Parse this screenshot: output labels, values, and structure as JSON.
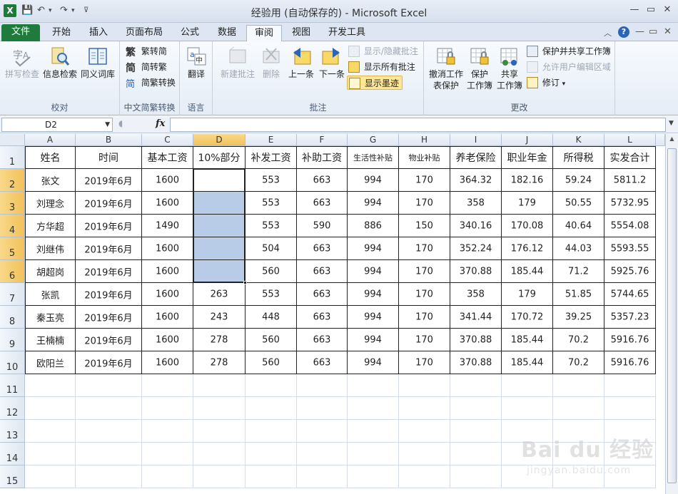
{
  "window": {
    "title": "经验用 (自动保存的) - Microsoft Excel",
    "app_icon": "X"
  },
  "tabs": [
    {
      "label": "文件"
    },
    {
      "label": "开始"
    },
    {
      "label": "插入"
    },
    {
      "label": "页面布局"
    },
    {
      "label": "公式"
    },
    {
      "label": "数据"
    },
    {
      "label": "审阅"
    },
    {
      "label": "视图"
    },
    {
      "label": "开发工具"
    }
  ],
  "active_tab": "审阅",
  "ribbon": {
    "proofing": {
      "label": "校对",
      "spell": "拼写检查",
      "research": "信息检索",
      "thesaurus": "同义词库"
    },
    "chinese": {
      "label": "中文简繁转换",
      "to_simplified_icon": "繁",
      "to_simplified": "繁转简",
      "to_traditional_icon": "简",
      "to_traditional": "简转繁",
      "convert_icon": "简",
      "convert": "简繁转换"
    },
    "language": {
      "label": "语言",
      "translate": "翻译"
    },
    "comments": {
      "label": "批注",
      "new": "新建批注",
      "delete": "删除",
      "prev": "上一条",
      "next": "下一条",
      "show_hide": "显示/隐藏批注",
      "show_all": "显示所有批注",
      "show_ink": "显示墨迹"
    },
    "changes": {
      "label": "更改",
      "unprotect_sheet_1": "撤消工作",
      "unprotect_sheet_2": "表保护",
      "protect_wb_1": "保护",
      "protect_wb_2": "工作簿",
      "share_wb_1": "共享",
      "share_wb_2": "工作簿",
      "protect_share": "保护并共享工作簿",
      "allow_edit": "允许用户编辑区域",
      "track": "修订"
    }
  },
  "formula_bar": {
    "name_box": "D2",
    "fx": "fx",
    "formula": ""
  },
  "grid": {
    "columns": [
      "A",
      "B",
      "C",
      "D",
      "E",
      "F",
      "G",
      "H",
      "I",
      "J",
      "K",
      "L"
    ],
    "row_numbers": [
      "1",
      "2",
      "3",
      "4",
      "5",
      "6",
      "7",
      "8",
      "9",
      "10",
      "11",
      "12",
      "13",
      "14",
      "15"
    ],
    "selected_column": "D",
    "selected_rows": [
      "2",
      "3",
      "4",
      "5",
      "6"
    ],
    "header": [
      "姓名",
      "时间",
      "基本工资",
      "10%部分",
      "补发工资",
      "补助工资",
      "生活性补贴",
      "物业补贴",
      "养老保险",
      "职业年金",
      "所得税",
      "实发合计"
    ],
    "rows": [
      [
        "张文",
        "2019年6月",
        "1600",
        "",
        "553",
        "663",
        "994",
        "170",
        "364.32",
        "182.16",
        "59.24",
        "5811.2"
      ],
      [
        "刘理念",
        "2019年6月",
        "1600",
        "",
        "553",
        "663",
        "994",
        "170",
        "358",
        "179",
        "50.55",
        "5732.95"
      ],
      [
        "方华超",
        "2019年6月",
        "1490",
        "",
        "553",
        "590",
        "886",
        "150",
        "340.16",
        "170.08",
        "40.64",
        "5554.08"
      ],
      [
        "刘继伟",
        "2019年6月",
        "1600",
        "",
        "504",
        "663",
        "994",
        "170",
        "352.24",
        "176.12",
        "44.03",
        "5593.55"
      ],
      [
        "胡超岗",
        "2019年6月",
        "1600",
        "",
        "560",
        "663",
        "994",
        "170",
        "370.88",
        "185.44",
        "71.2",
        "5925.76"
      ],
      [
        "张凯",
        "2019年6月",
        "1600",
        "263",
        "553",
        "663",
        "994",
        "170",
        "358",
        "179",
        "51.85",
        "5744.65"
      ],
      [
        "秦玉亮",
        "2019年6月",
        "1600",
        "243",
        "448",
        "663",
        "994",
        "170",
        "341.44",
        "170.72",
        "39.25",
        "5357.23"
      ],
      [
        "王楠楠",
        "2019年6月",
        "1600",
        "278",
        "560",
        "663",
        "994",
        "170",
        "370.88",
        "185.44",
        "70.2",
        "5916.76"
      ],
      [
        "欧阳兰",
        "2019年6月",
        "1600",
        "278",
        "560",
        "663",
        "994",
        "170",
        "370.88",
        "185.44",
        "70.2",
        "5916.76"
      ]
    ]
  },
  "watermark": {
    "brand": "Bai du 经验",
    "site": "jingyan.baidu.com"
  },
  "colors": {
    "accent": "#1e7b3c",
    "selection": "#b8cce8",
    "header_highlight": "#f1c15a"
  }
}
